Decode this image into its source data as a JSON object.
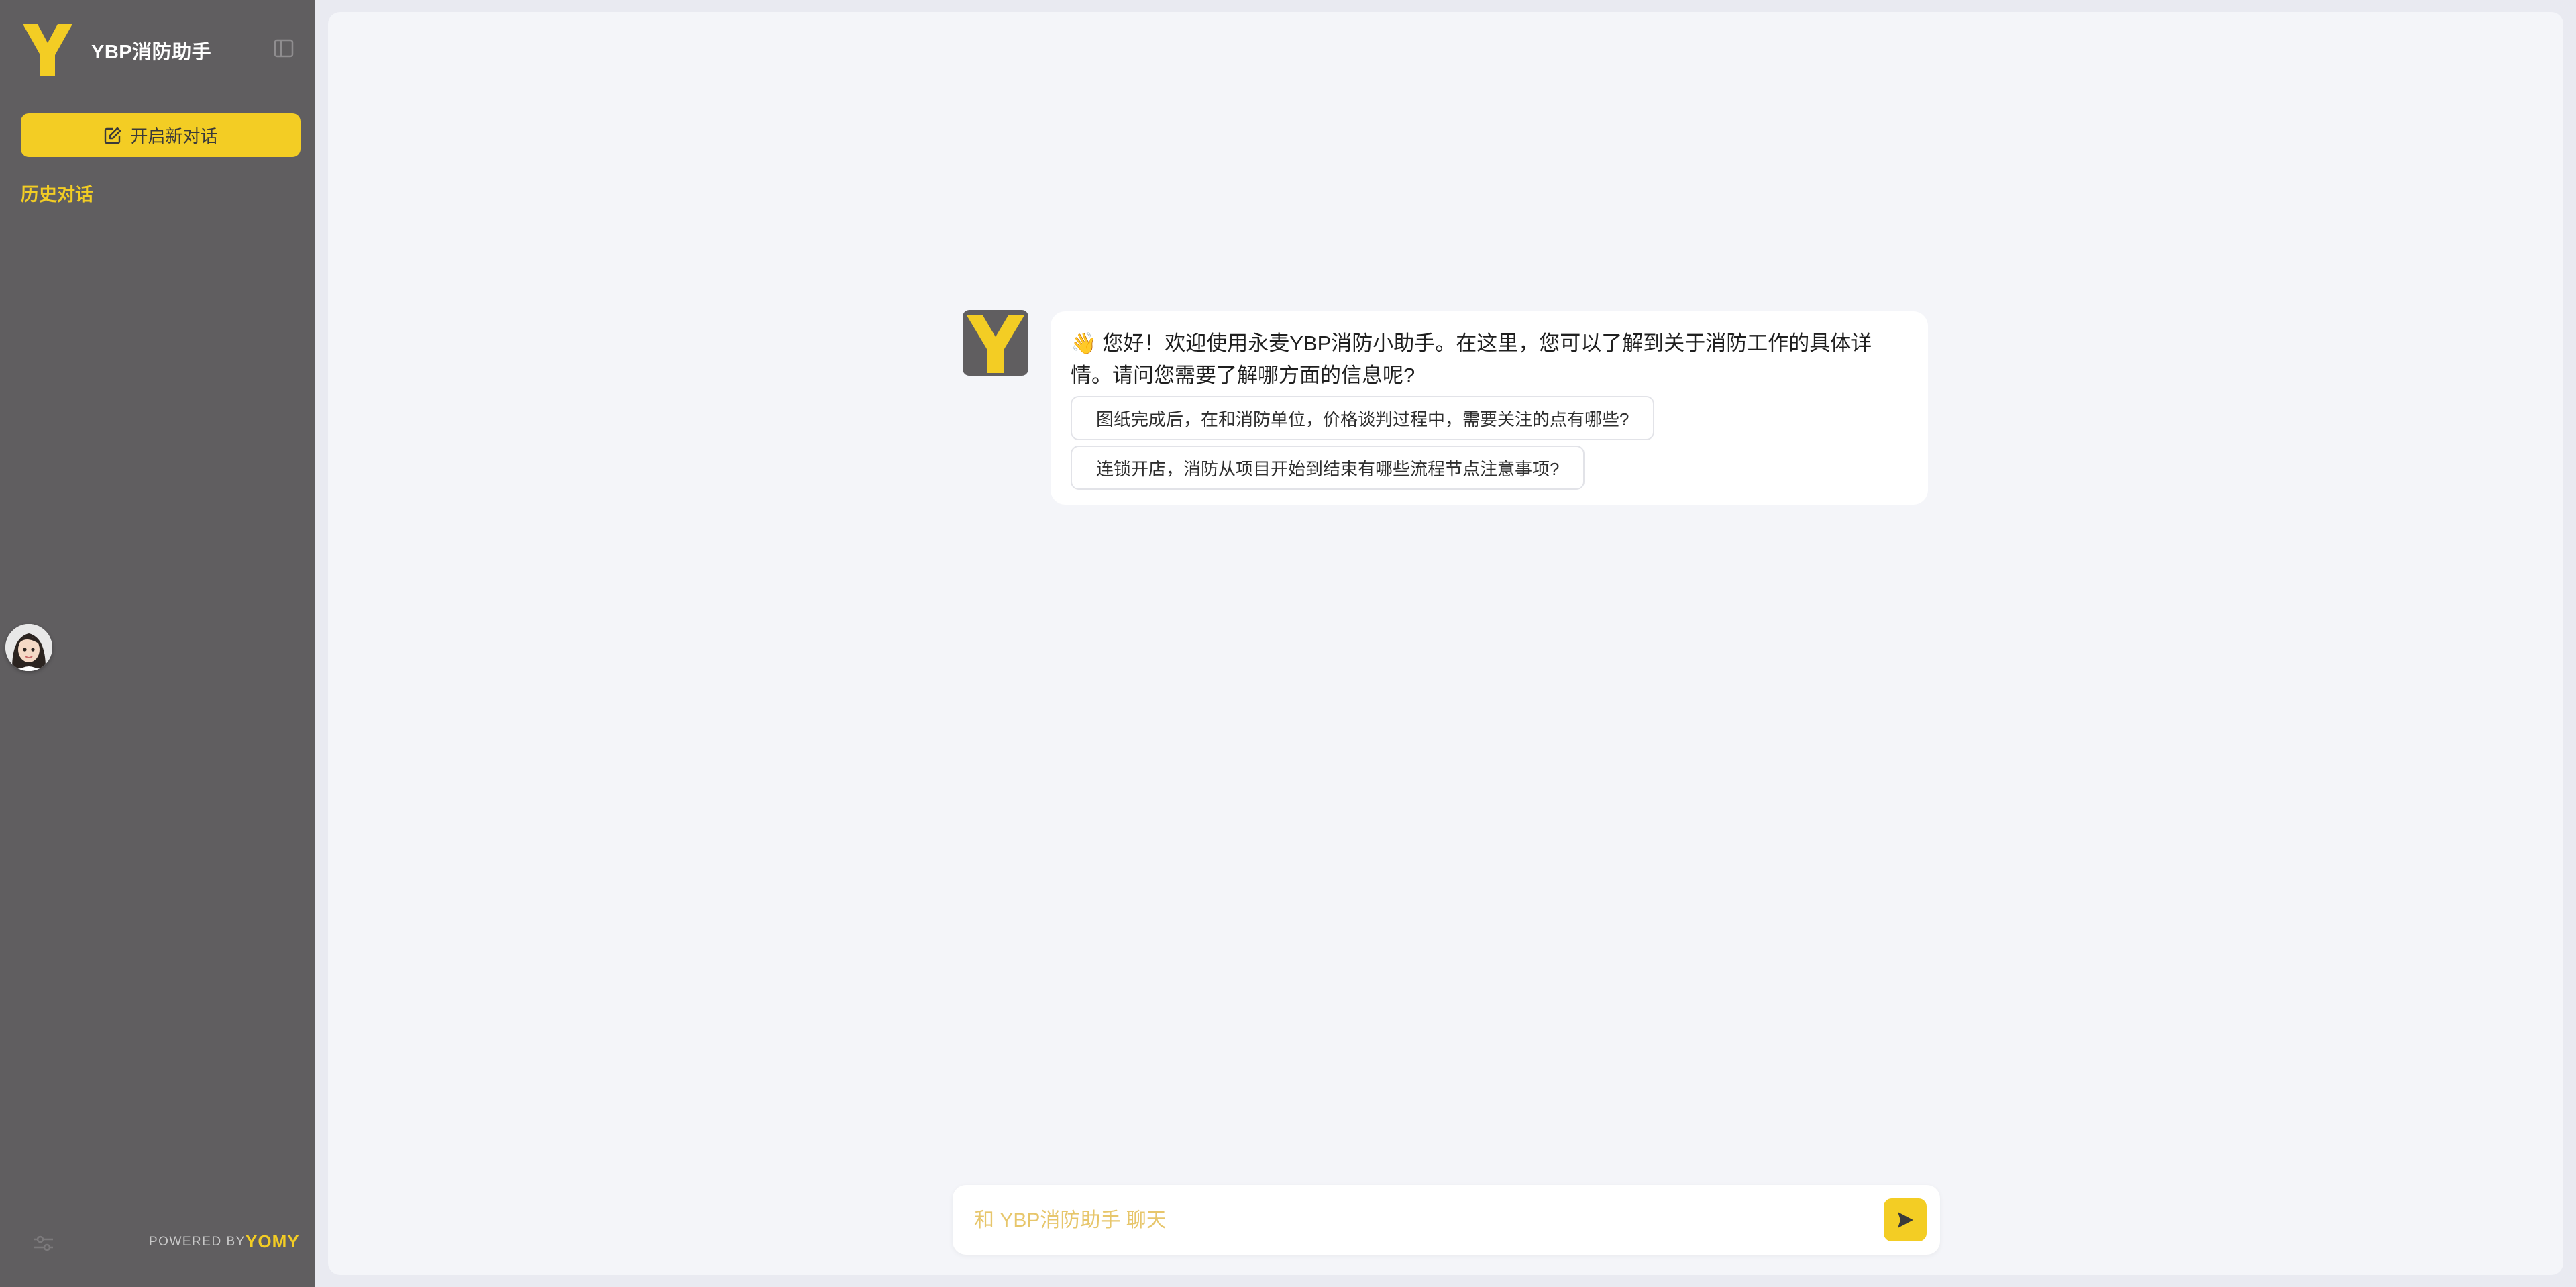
{
  "sidebar": {
    "app_title": "YBP消防助手",
    "new_chat_label": "开启新对话",
    "history_label": "历史对话",
    "powered_by": "POWERED BY",
    "brand": "YOMY"
  },
  "chat": {
    "greeting_emoji": "👋",
    "greeting": "您好！欢迎使用永麦YBP消防小助手。在这里，您可以了解到关于消防工作的具体详情。请问您需要了解哪方面的信息呢?",
    "suggestions": [
      "图纸完成后，在和消防单位，价格谈判过程中，需要关注的点有哪些?",
      "连锁开店，消防从项目开始到结束有哪些流程节点注意事项?"
    ]
  },
  "input": {
    "placeholder": "和 YBP消防助手 聊天"
  },
  "colors": {
    "accent": "#f3cd24",
    "sidebar_bg": "#605e60",
    "main_bg": "#f4f5f9"
  },
  "icons": {
    "logo": "y-logo-icon",
    "collapse": "sidebar-collapse-icon",
    "new_chat": "edit-icon",
    "settings": "sliders-icon",
    "send": "send-icon"
  }
}
